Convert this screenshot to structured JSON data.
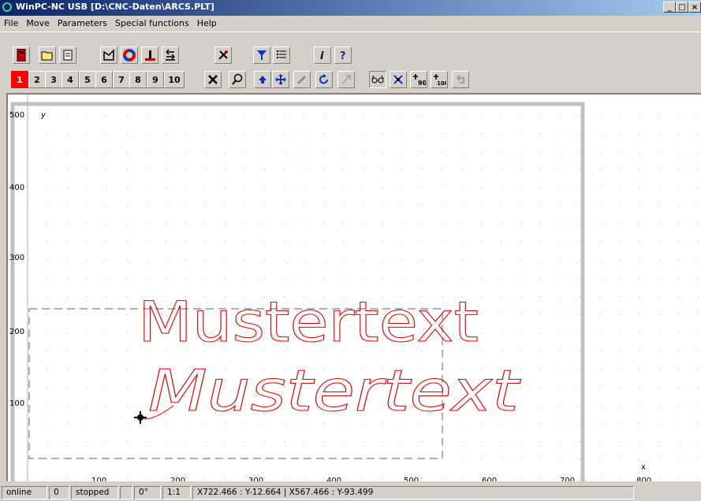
{
  "window": {
    "title": "WinPC-NC USB [D:\\CNC-Daten\\ARCS.PLT]",
    "controls": [
      "_",
      "□",
      "×"
    ]
  },
  "menu": {
    "items": [
      "File",
      "Move",
      "Parameters",
      "Special functions",
      "Help"
    ]
  },
  "toolbar1": {
    "icons": [
      "exit-icon",
      "open-folder-icon",
      "document-icon",
      "curve-tool-icon",
      "color-wheel-icon",
      "reference-icon",
      "return-icon",
      "tools-icon",
      "filter-icon",
      "list-icon",
      "info-icon",
      "help-icon"
    ]
  },
  "toolbar2": {
    "numbers": [
      "1",
      "2",
      "3",
      "4",
      "5",
      "6",
      "7",
      "8",
      "9",
      "10"
    ],
    "active_number": "1",
    "icons": [
      "cancel-x-icon",
      "zoom-icon",
      "up-arrow-icon",
      "move-cross-icon",
      "disabled-tool-icon",
      "rotate-icon",
      "disabled-spark-icon",
      "glasses-icon",
      "center-x-icon",
      "rotate-90-icon",
      "rotate-100-icon",
      "undo-icon"
    ]
  },
  "plot": {
    "y_axis_label": "y",
    "x_axis_label": "x",
    "y_ticks": [
      "500",
      "400",
      "300",
      "200",
      "100"
    ],
    "x_ticks": [
      "100",
      "200",
      "300",
      "400",
      "500",
      "600",
      "700",
      "800"
    ],
    "text_outline": "Mustertext",
    "text_script": "Mustertext",
    "stroke_color": "#e00000",
    "frame_color": "#c0c0c0",
    "dash_color": "#808080"
  },
  "status": {
    "connection": "online",
    "count": "0",
    "state": "stopped",
    "blank": "",
    "angle": "0°",
    "scale": "1:1",
    "coords": "X722.466 : Y-12.664  |  X567.466 : Y-93.499"
  }
}
